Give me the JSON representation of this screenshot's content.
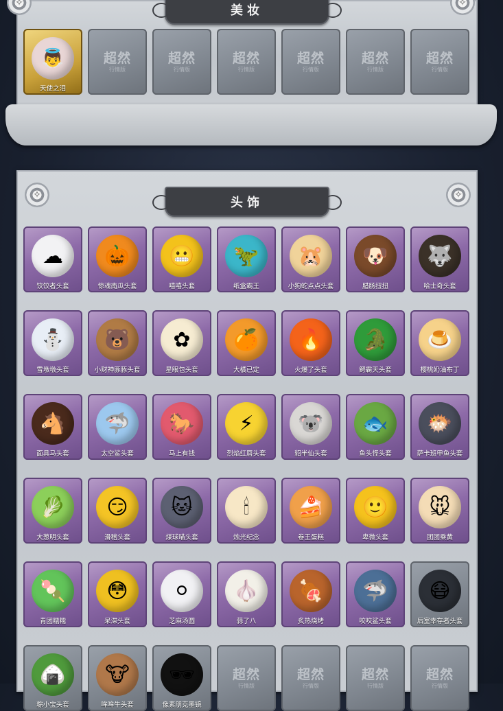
{
  "sections": {
    "makeup": {
      "title": "美妆",
      "items": [
        {
          "label": "天使之泪",
          "icon": "angel-tear-icon",
          "state": "owned",
          "color": "#d8c6c8"
        }
      ],
      "placeholder_text": "超然",
      "placeholder_sub": "行情版"
    },
    "headwear": {
      "title": "头饰",
      "placeholder_text": "超然",
      "placeholder_sub": "行情版",
      "items": [
        {
          "label": "饺饺者头套",
          "icon": "dumpling-head-icon",
          "color": "#f2f2f4"
        },
        {
          "label": "惊魂南瓜头套",
          "icon": "pumpkin-head-icon",
          "color": "#f08a1e"
        },
        {
          "label": "嘻嘻头套",
          "icon": "grin-face-icon",
          "color": "#f3c21b"
        },
        {
          "label": "纸盒霸王",
          "icon": "box-dino-icon",
          "color": "#3bb6c9"
        },
        {
          "label": "小狗蛇点点头套",
          "icon": "hamster-head-icon",
          "color": "#f0d39a"
        },
        {
          "label": "腊肠扭扭",
          "icon": "dachshund-head-icon",
          "color": "#7a4a2a"
        },
        {
          "label": "哈士奇头套",
          "icon": "husky-head-icon",
          "color": "#3b3128"
        },
        {
          "label": "雪墩墩头套",
          "icon": "snowman-head-icon",
          "color": "#e8eef6"
        },
        {
          "label": "小财神豚豚头套",
          "icon": "capybara-head-icon",
          "color": "#b07b45"
        },
        {
          "label": "星眼包头套",
          "icon": "bun-head-icon",
          "color": "#f6ecd2"
        },
        {
          "label": "大橘已定",
          "icon": "orange-head-icon",
          "color": "#f39a2b"
        },
        {
          "label": "火爆了头套",
          "icon": "flame-head-icon",
          "color": "#f4631a"
        },
        {
          "label": "鳄霸天头套",
          "icon": "crocodile-head-icon",
          "color": "#2f9b3a"
        },
        {
          "label": "樱桃奶油布丁",
          "icon": "pudding-head-icon",
          "color": "#f6d28a"
        },
        {
          "label": "面具马头套",
          "icon": "horse-head-icon",
          "color": "#4a2a1c"
        },
        {
          "label": "太空鲨头套",
          "icon": "shark-head-icon",
          "color": "#9cc8ee"
        },
        {
          "label": "马上有钱",
          "icon": "red-horse-head-icon",
          "color": "#e25a6e"
        },
        {
          "label": "烈焰红唇头套",
          "icon": "pikachu-head-icon",
          "color": "#f7d331"
        },
        {
          "label": "貂半仙头套",
          "icon": "ferret-head-icon",
          "color": "#d9d7d4"
        },
        {
          "label": "鱼头怪头套",
          "icon": "fish-head-icon",
          "color": "#6aa843"
        },
        {
          "label": "萨卡班甲鱼头套",
          "icon": "sacabambaspis-head-icon",
          "color": "#4a4e5c"
        },
        {
          "label": "大葱明头套",
          "icon": "bokchoy-head-icon",
          "color": "#8ccf5a"
        },
        {
          "label": "滑稽头套",
          "icon": "funny-face-icon",
          "color": "#f4c425"
        },
        {
          "label": "煤球喵头套",
          "icon": "gray-cat-head-icon",
          "color": "#5c6072"
        },
        {
          "label": "烛光纪念",
          "icon": "candle-head-icon",
          "color": "#f7e7c6"
        },
        {
          "label": "卷王蛋糕",
          "icon": "roll-cake-icon",
          "color": "#f0a04a"
        },
        {
          "label": "卑微头套",
          "icon": "humble-face-icon",
          "color": "#f5c21d"
        },
        {
          "label": "团团乘黄",
          "icon": "hamster-bun-icon",
          "color": "#f4dcb6"
        },
        {
          "label": "青团糯糯",
          "icon": "green-rice-ball-icon",
          "color": "#62c45a"
        },
        {
          "label": "呆滞头套",
          "icon": "dazed-face-icon",
          "color": "#efc021"
        },
        {
          "label": "芝麻汤圆",
          "icon": "sesame-ball-icon",
          "color": "#f1f1f4"
        },
        {
          "label": "蒜了八",
          "icon": "garlic-head-icon",
          "color": "#f2f0e8"
        },
        {
          "label": "炙热烧烤",
          "icon": "bbq-head-icon",
          "color": "#b9642c"
        },
        {
          "label": "咬咬鲨头套",
          "icon": "biting-shark-icon",
          "color": "#4c6f96"
        },
        {
          "label": "后室幸存者头套",
          "icon": "gas-mask-icon",
          "color": "#2b2f36"
        },
        {
          "label": "粽小宝头套",
          "icon": "zongzi-head-icon",
          "color": "#4f9a3c"
        },
        {
          "label": "哞哞牛头套",
          "icon": "cow-head-icon",
          "color": "#b0784a"
        },
        {
          "label": "像素朋克墨镜",
          "icon": "pixel-glasses-icon",
          "color": "#111111"
        }
      ]
    }
  }
}
